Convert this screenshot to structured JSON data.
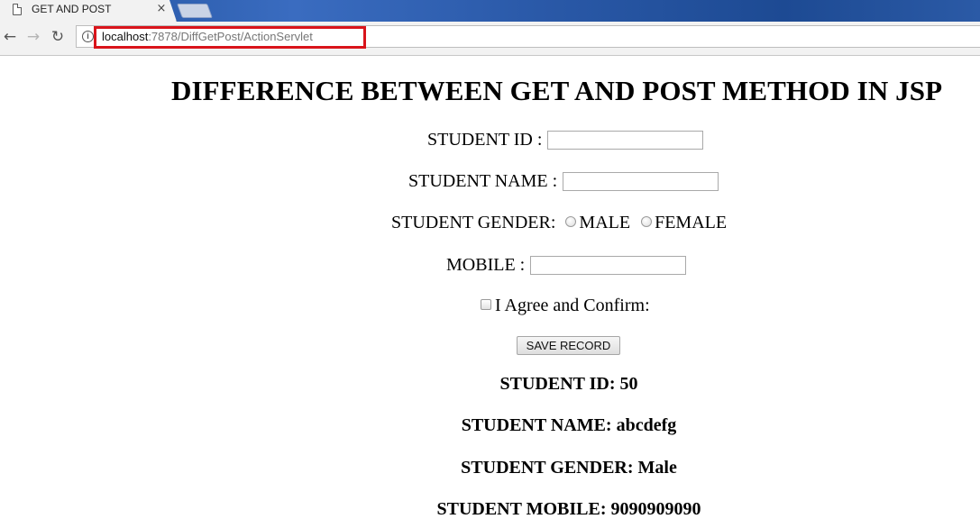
{
  "browser": {
    "tab_title": "GET AND POST",
    "tab_close_glyph": "×",
    "nav": {
      "back_glyph": "←",
      "forward_glyph": "→",
      "reload_glyph": "↻"
    },
    "address_bar": {
      "info_glyph": "i",
      "host": "localhost",
      "path": ":7878/DiffGetPost/ActionServlet",
      "highlight_color": "#d9141b"
    }
  },
  "page": {
    "title": "DIFFERENCE BETWEEN GET AND POST METHOD IN JSP",
    "form": {
      "student_id_label": "STUDENT ID :",
      "student_id_value": "",
      "student_name_label": "STUDENT NAME :",
      "student_name_value": "",
      "gender_label": "STUDENT GENDER:",
      "gender_options": [
        "MALE",
        "FEMALE"
      ],
      "mobile_label": "MOBILE :",
      "mobile_value": "",
      "agree_label": "I Agree and Confirm:",
      "agree_checked": false,
      "submit_label": "SAVE RECORD"
    },
    "results": {
      "student_id": "STUDENT ID: 50",
      "student_name": "STUDENT NAME: abcdefg",
      "student_gender": "STUDENT GENDER: Male",
      "student_mobile": "STUDENT MOBILE: 9090909090"
    }
  }
}
